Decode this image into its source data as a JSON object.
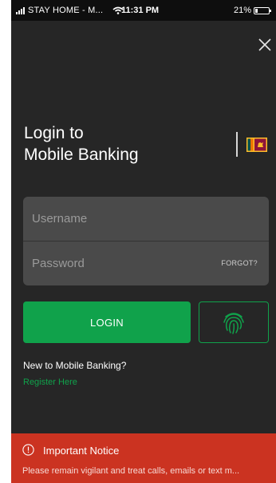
{
  "status_bar": {
    "carrier": "STAY HOME - M...",
    "time": "11:31 PM",
    "battery_text": "21%",
    "battery_level": 0.21,
    "icons": [
      "signal-icon",
      "wifi-icon",
      "battery-icon"
    ]
  },
  "header": {
    "title_line1": "Login to",
    "title_line2": "Mobile Banking",
    "close_icon": "close-icon",
    "flag_icon": "sri-lanka-flag-icon"
  },
  "form": {
    "username_placeholder": "Username",
    "password_placeholder": "Password",
    "forgot_label": "FORGOT?",
    "login_label": "LOGIN",
    "fingerprint_icon": "fingerprint-icon"
  },
  "register": {
    "prompt": "New to Mobile Banking?",
    "link": "Register Here"
  },
  "notice": {
    "icon": "info-icon",
    "title": "Important Notice",
    "text": "Please remain vigilant and treat calls, emails or text m..."
  },
  "colors": {
    "background": "#262626",
    "accent": "#10a24b",
    "input": "#4a4a4a",
    "notice": "#cb3321"
  }
}
